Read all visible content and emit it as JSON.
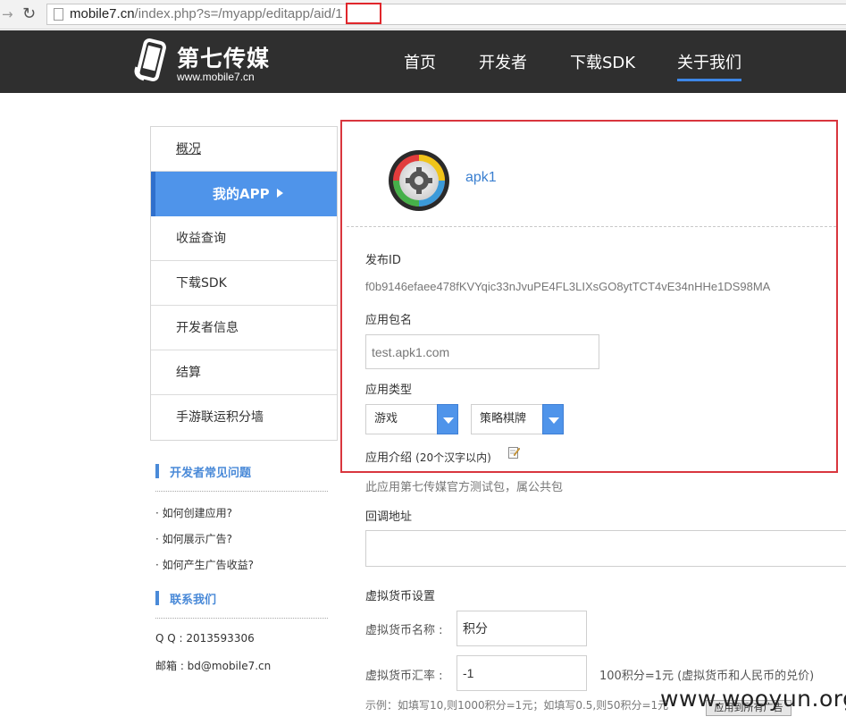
{
  "browser": {
    "url_host": "mobile7.cn",
    "url_path": "/index.php?s=/myapp/editapp/aid/1"
  },
  "header": {
    "logo_title": "第七传媒",
    "logo_subtitle": "www.mobile7.cn",
    "nav": [
      "首页",
      "开发者",
      "下载SDK",
      "关于我们"
    ],
    "active_nav": "关于我们",
    "accent_color": "#3d86e6"
  },
  "sidebar": {
    "items": [
      {
        "label": "概况"
      },
      {
        "label": "我的APP",
        "active": true
      },
      {
        "label": "收益查询"
      },
      {
        "label": "下载SDK"
      },
      {
        "label": "开发者信息"
      },
      {
        "label": "结算"
      },
      {
        "label": "手游联运积分墙"
      }
    ],
    "faq_title": "开发者常见问题",
    "faq": [
      "· 如何创建应用?",
      "· 如何展示广告?",
      "· 如何产生广告收益?"
    ],
    "contact_title": "联系我们",
    "contact": {
      "qq": "Q Q : 2013593306",
      "email": "邮箱 : bd@mobile7.cn"
    }
  },
  "app": {
    "name": "apk1",
    "icon": "gear-app-icon",
    "release_id_label": "发布ID",
    "release_id": "f0b9146efaee478fKVYqic33nJvuPE4FL3LIXsGO8ytTCT4vE34nHHe1DS98MA",
    "package_label": "应用包名",
    "package_value": "test.apk1.com",
    "type_label": "应用类型",
    "type_primary": "游戏",
    "type_secondary": "策略棋牌",
    "intro_label": "应用介绍",
    "intro_hint": "(20个汉字以内)",
    "intro_value": "此应用第七传媒官方测试包，属公共包",
    "callback_label": "回调地址",
    "callback_value": "",
    "currency_section": "虚拟货币设置",
    "currency_name_label": "虚拟货币名称 :",
    "currency_name_value": "积分",
    "currency_rate_label": "虚拟货币汇率 :",
    "currency_rate_value": "-1",
    "rate_note": "100积分=1元 (虚拟货币和人民币的兑价)",
    "example": "示例：如填写10,则1000积分=1元；如填写0.5,则50积分=1元",
    "apply_button": "应用到所有广告"
  },
  "watermark": "www.wooyun.org"
}
